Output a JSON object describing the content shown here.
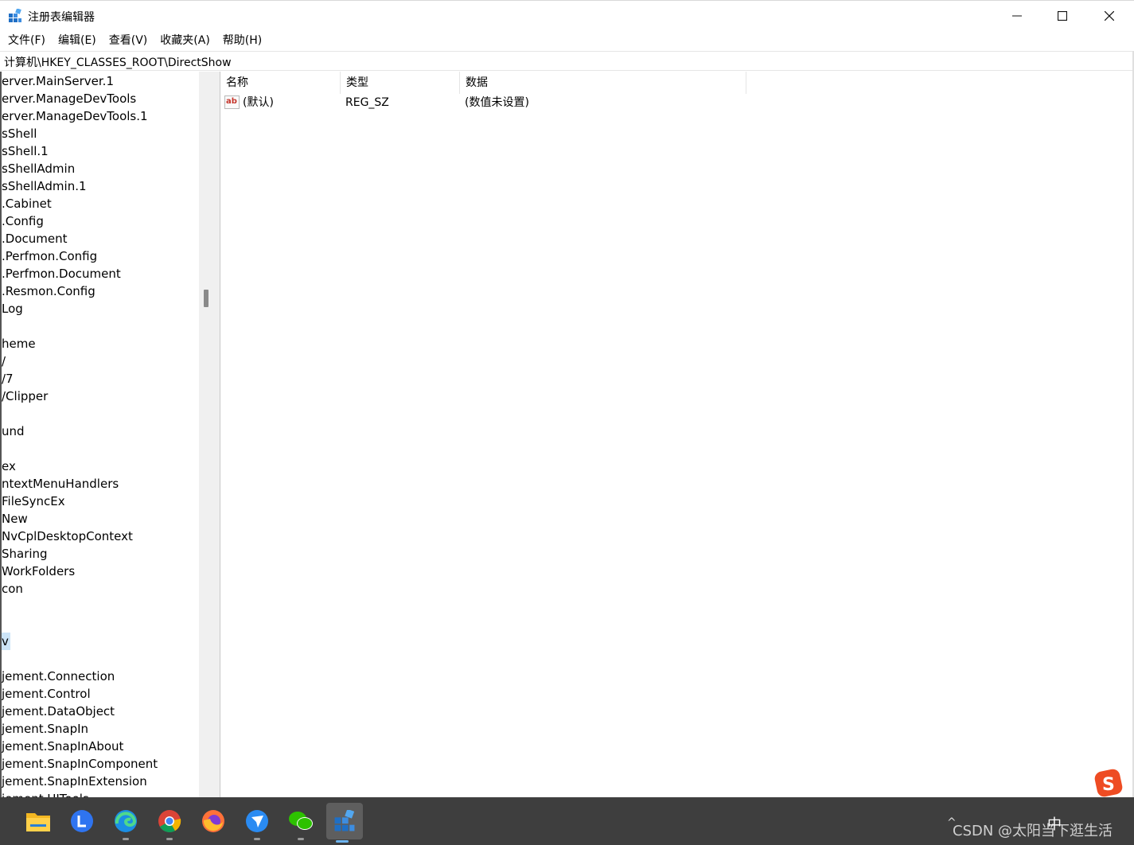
{
  "window": {
    "title": "注册表编辑器",
    "minimize_icon": "minimize-icon",
    "maximize_icon": "maximize-icon",
    "close_icon": "close-icon"
  },
  "menu": {
    "items": [
      {
        "label": "文件(F)"
      },
      {
        "label": "编辑(E)"
      },
      {
        "label": "查看(V)"
      },
      {
        "label": "收藏夹(A)"
      },
      {
        "label": "帮助(H)"
      }
    ]
  },
  "address": {
    "path": "计算机\\HKEY_CLASSES_ROOT\\DirectShow"
  },
  "tree": {
    "selected_label": "v",
    "nodes": [
      {
        "label": "erver.MainServer.1"
      },
      {
        "label": "erver.ManageDevTools"
      },
      {
        "label": "erver.ManageDevTools.1"
      },
      {
        "label": "sShell"
      },
      {
        "label": "sShell.1"
      },
      {
        "label": "sShellAdmin"
      },
      {
        "label": "sShellAdmin.1"
      },
      {
        "label": ".Cabinet"
      },
      {
        "label": ".Config"
      },
      {
        "label": ".Document"
      },
      {
        "label": ".Perfmon.Config"
      },
      {
        "label": ".Perfmon.Document"
      },
      {
        "label": ".Resmon.Config"
      },
      {
        "label": "Log"
      },
      {
        "label": ""
      },
      {
        "label": "heme"
      },
      {
        "label": "/"
      },
      {
        "label": "/7"
      },
      {
        "label": "/Clipper"
      },
      {
        "label": ""
      },
      {
        "label": "und"
      },
      {
        "label": ""
      },
      {
        "label": "ex"
      },
      {
        "label": "ntextMenuHandlers"
      },
      {
        "label": " FileSyncEx"
      },
      {
        "label": " New"
      },
      {
        "label": " NvCplDesktopContext"
      },
      {
        "label": " Sharing"
      },
      {
        "label": " WorkFolders"
      },
      {
        "label": "con"
      },
      {
        "label": ""
      },
      {
        "label": ""
      },
      {
        "label": "v"
      },
      {
        "label": ""
      },
      {
        "label": "jement.Connection"
      },
      {
        "label": "jement.Control"
      },
      {
        "label": "jement.DataObject"
      },
      {
        "label": "jement.SnapIn"
      },
      {
        "label": "jement.SnapInAbout"
      },
      {
        "label": "jement.SnapInComponent"
      },
      {
        "label": "jement.SnapInExtension"
      },
      {
        "label": "jement.UITools"
      }
    ]
  },
  "list": {
    "columns": [
      {
        "label": "名称"
      },
      {
        "label": "类型"
      },
      {
        "label": "数据"
      }
    ],
    "rows": [
      {
        "icon": "string-value-icon",
        "icon_text": "ab",
        "name": "(默认)",
        "type": "REG_SZ",
        "data": "(数值未设置)"
      }
    ]
  },
  "taskbar": {
    "apps": [
      {
        "icon": "file-explorer-icon"
      },
      {
        "icon": "lark-l-icon"
      },
      {
        "icon": "edge-icon"
      },
      {
        "icon": "chrome-icon"
      },
      {
        "icon": "firefox-icon"
      },
      {
        "icon": "feishu-icon"
      },
      {
        "icon": "wechat-icon"
      },
      {
        "icon": "registry-editor-icon"
      }
    ],
    "ime_label": "中",
    "tray_chevron": "^",
    "watermark": "CSDN @太阳当下逛生活"
  }
}
